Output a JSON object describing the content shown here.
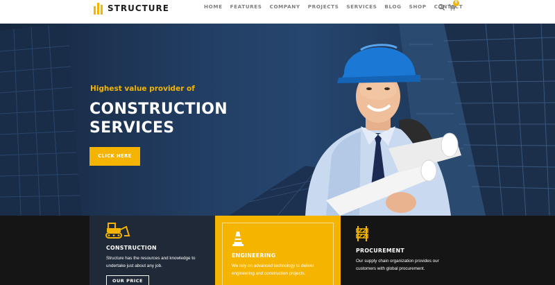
{
  "brand": {
    "name": "STRUCTURE",
    "accent": "#f5b400"
  },
  "nav": {
    "items": [
      "HOME",
      "FEATURES",
      "COMPANY",
      "PROJECTS",
      "SERVICES",
      "BLOG",
      "SHOP",
      "CONTACT"
    ]
  },
  "header_icons": {
    "search_icon": "magnifier",
    "cart_icon": "shopping-cart",
    "cart_count": "0"
  },
  "hero": {
    "subtitle": "Highest value provider of",
    "title_line1": "CONSTRUCTION",
    "title_line2": "SERVICES",
    "button": "CLICK HERE"
  },
  "cards": [
    {
      "icon": "bulldozer-icon",
      "title": "CONSTRUCTION",
      "text": "Structure has the resources and knowledge to undertake just about any job.",
      "button": "OUR PRICE"
    },
    {
      "icon": "traffic-cone-icon",
      "title": "ENGINEERING",
      "text": "We rely on advanced technology to deliver engineering and construction projects."
    },
    {
      "icon": "road-barrier-icon",
      "title": "PROCUREMENT",
      "text": "Our supply chain organization provides our customers with global procurement."
    }
  ],
  "colors": {
    "hero_bg": "#223d62",
    "card_dark": "#1f2937",
    "card_accent": "#f5b400",
    "strip_bg": "#151515"
  }
}
